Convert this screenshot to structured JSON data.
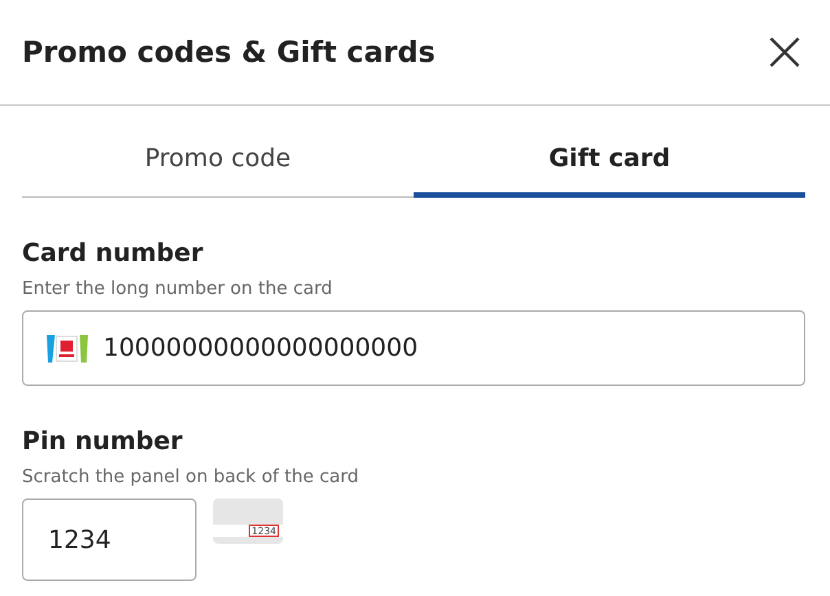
{
  "dialog": {
    "title": "Promo codes & Gift cards"
  },
  "tabs": [
    {
      "label": "Promo code",
      "selected": false
    },
    {
      "label": "Gift card",
      "selected": true
    }
  ],
  "card_number": {
    "label": "Card number",
    "hint": "Enter the long number on the card",
    "value": "10000000000000000000"
  },
  "pin_number": {
    "label": "Pin number",
    "hint": "Scratch the panel on back of the card",
    "value": "1234",
    "card_sample": "1234"
  }
}
